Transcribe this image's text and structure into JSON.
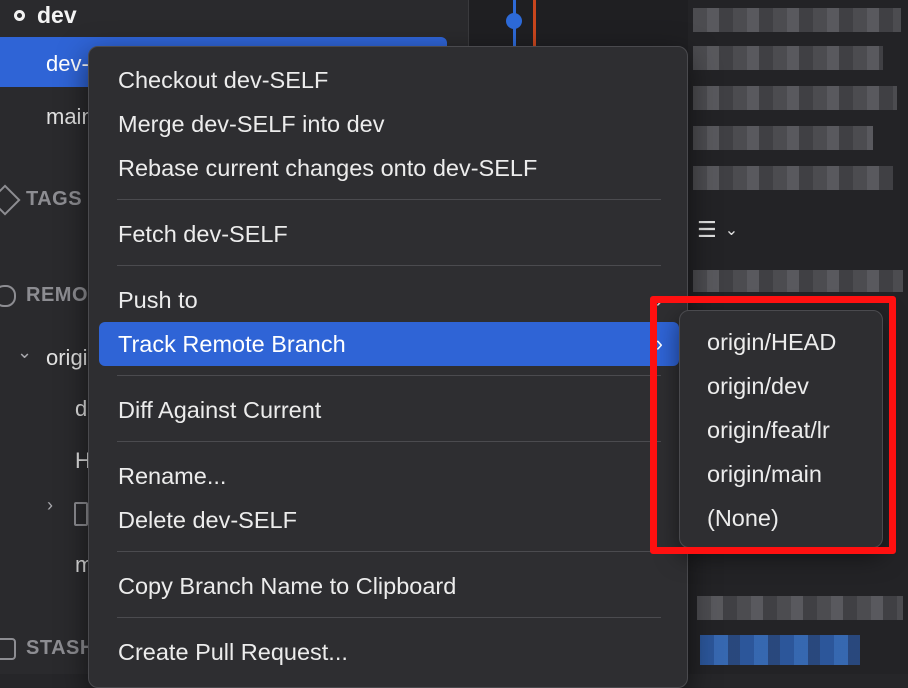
{
  "sidebar": {
    "current_branch": "dev",
    "local_branches": [
      "dev-SELF",
      "main"
    ],
    "sections": {
      "tags": "TAGS",
      "remotes": "REMOTES",
      "stashes": "STASHES"
    },
    "remote_name": "origin",
    "remote_items": [
      "dev",
      "HEAD",
      "main"
    ]
  },
  "context_menu": {
    "items": [
      {
        "label": "Checkout dev-SELF"
      },
      {
        "label": "Merge dev-SELF into dev"
      },
      {
        "label": "Rebase current changes onto dev-SELF"
      },
      {
        "label": "Fetch dev-SELF"
      },
      {
        "label": "Push to",
        "submenu_arrow": "›"
      },
      {
        "label": "Track Remote Branch",
        "submenu_arrow": "›",
        "highlighted": true
      },
      {
        "label": "Diff Against Current"
      },
      {
        "label": "Rename..."
      },
      {
        "label": "Delete dev-SELF"
      },
      {
        "label": "Copy Branch Name to Clipboard"
      },
      {
        "label": "Create Pull Request..."
      }
    ]
  },
  "submenu": {
    "items": [
      "origin/HEAD",
      "origin/dev",
      "origin/feat/lr",
      "origin/main",
      "(None)"
    ]
  },
  "toolbar": {
    "list_icon": "list-icon",
    "dropdown_icon": "chevron-down-icon"
  },
  "colors": {
    "accent": "#2f64d6",
    "highlight_box": "#ff1010",
    "menu_bg": "#2e2e31"
  }
}
